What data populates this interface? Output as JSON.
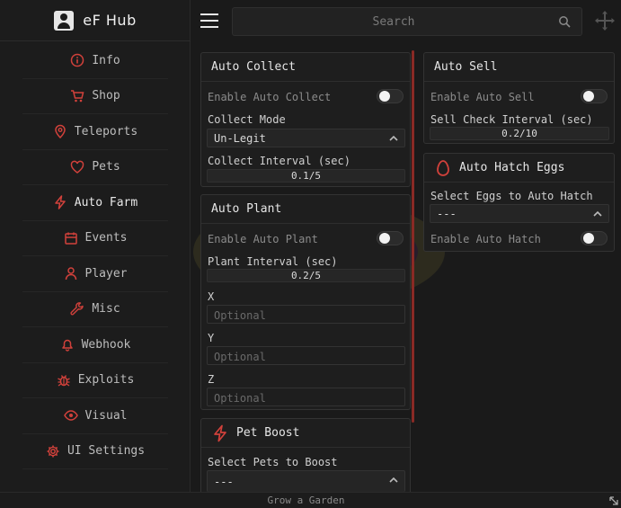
{
  "app": {
    "name": "eF Hub",
    "accent": "#d1413b"
  },
  "sidebar": {
    "items": [
      {
        "label": "Info",
        "icon": "info-icon"
      },
      {
        "label": "Shop",
        "icon": "cart-icon"
      },
      {
        "label": "Teleports",
        "icon": "location-pin-icon"
      },
      {
        "label": "Pets",
        "icon": "heart-icon"
      },
      {
        "label": "Auto Farm",
        "icon": "lightning-icon",
        "active": true
      },
      {
        "label": "Events",
        "icon": "calendar-icon"
      },
      {
        "label": "Player",
        "icon": "user-icon"
      },
      {
        "label": "Misc",
        "icon": "wrench-icon"
      },
      {
        "label": "Webhook",
        "icon": "bell-icon"
      },
      {
        "label": "Exploits",
        "icon": "bug-icon"
      },
      {
        "label": "Visual",
        "icon": "eye-icon"
      },
      {
        "label": "UI Settings",
        "icon": "gear-icon"
      }
    ]
  },
  "topbar": {
    "search_placeholder": "Search"
  },
  "auto_collect": {
    "title": "Auto Collect",
    "enable_label": "Enable Auto Collect",
    "mode_label": "Collect Mode",
    "mode_value": "Un-Legit",
    "interval_label": "Collect Interval (sec)",
    "interval_value": "0.1/5"
  },
  "auto_plant": {
    "title": "Auto Plant",
    "enable_label": "Enable Auto Plant",
    "interval_label": "Plant Interval (sec)",
    "interval_value": "0.2/5",
    "x_label": "X",
    "y_label": "Y",
    "z_label": "Z",
    "placeholder": "Optional"
  },
  "pet_boost": {
    "title": "Pet Boost",
    "select_label": "Select Pets to Boost",
    "select_value": "---"
  },
  "auto_sell": {
    "title": "Auto Sell",
    "enable_label": "Enable Auto Sell",
    "interval_label": "Sell Check Interval (sec)",
    "interval_value": "0.2/10"
  },
  "auto_hatch": {
    "title": "Auto Hatch Eggs",
    "select_label": "Select Eggs to Auto Hatch",
    "select_value": "---",
    "enable_label": "Enable Auto Hatch"
  },
  "footer": {
    "text": "Grow a Garden"
  }
}
